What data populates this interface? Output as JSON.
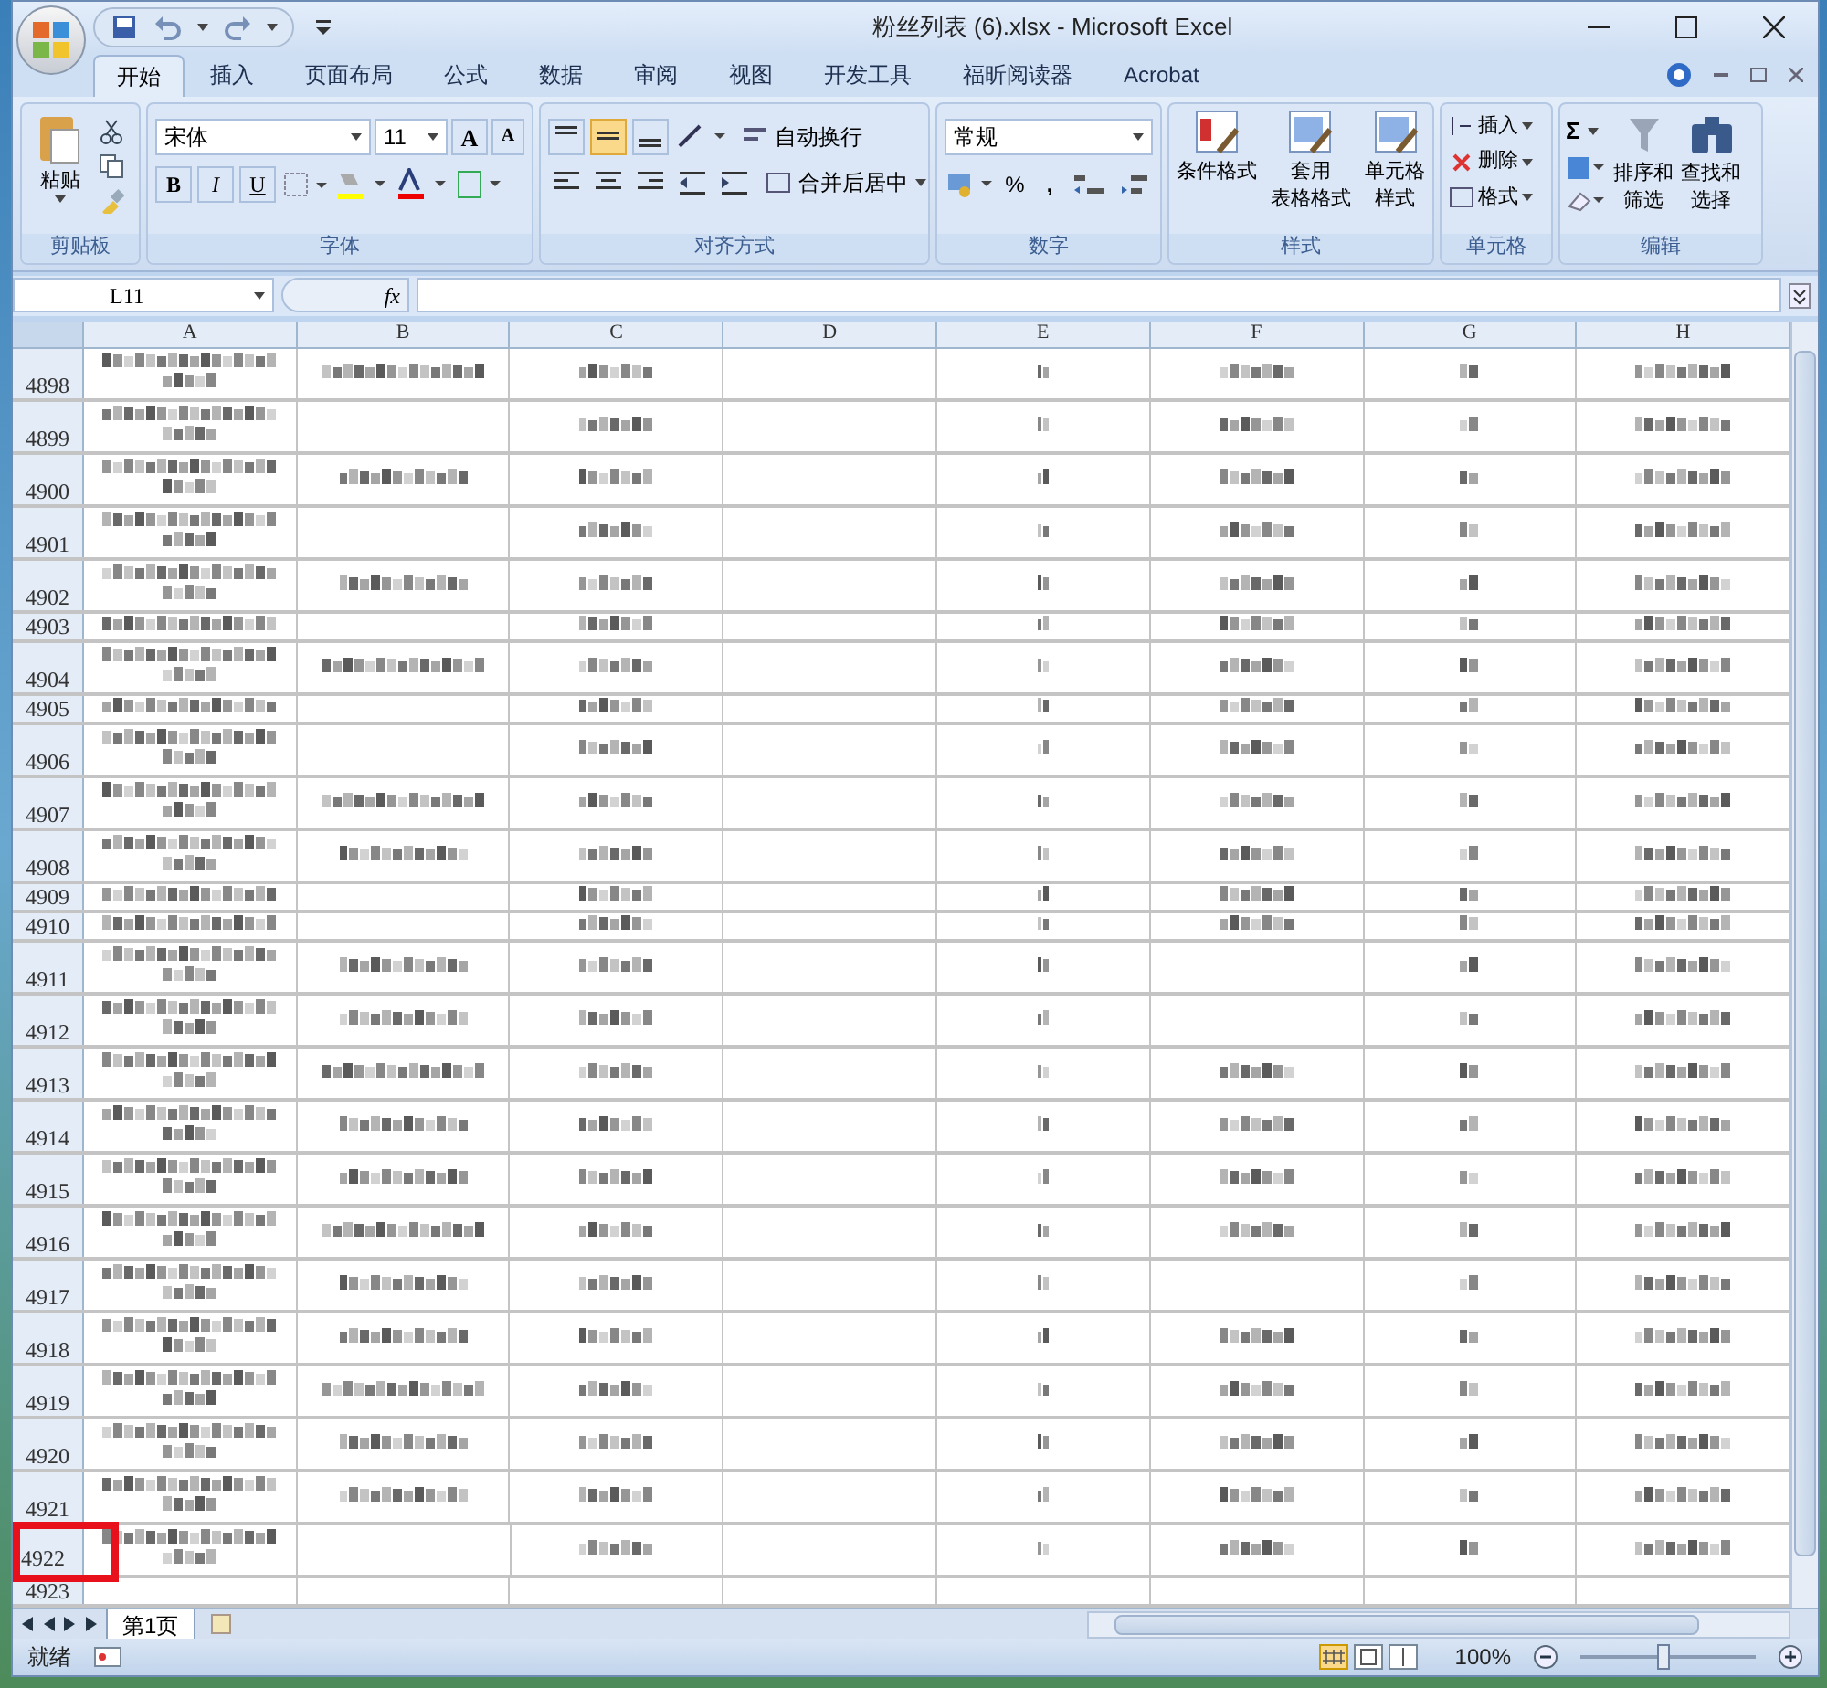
{
  "window": {
    "title": "粉丝列表 (6).xlsx - Microsoft Excel"
  },
  "tabs": [
    {
      "label": "开始",
      "selected": true
    },
    {
      "label": "插入",
      "selected": false
    },
    {
      "label": "页面布局",
      "selected": false
    },
    {
      "label": "公式",
      "selected": false
    },
    {
      "label": "数据",
      "selected": false
    },
    {
      "label": "审阅",
      "selected": false
    },
    {
      "label": "视图",
      "selected": false
    },
    {
      "label": "开发工具",
      "selected": false
    },
    {
      "label": "福昕阅读器",
      "selected": false
    },
    {
      "label": "Acrobat",
      "selected": false
    }
  ],
  "ribbon": {
    "clipboard": {
      "label": "剪贴板",
      "paste": "粘贴"
    },
    "font": {
      "label": "字体",
      "name": "宋体",
      "size": "11",
      "grow": "A",
      "shrink": "A",
      "bold": "B",
      "italic": "I",
      "underline": "U"
    },
    "alignment": {
      "label": "对齐方式",
      "vertical": [
        {
          "selected": false
        },
        {
          "selected": true
        },
        {
          "selected": false
        }
      ],
      "wrap": "自动换行",
      "merge": "合并后居中"
    },
    "number": {
      "label": "数字",
      "format": "常规",
      "percent": "%",
      "comma": ","
    },
    "styles": {
      "label": "样式",
      "buttons": [
        {
          "lines": [
            "条件格式"
          ]
        },
        {
          "lines": [
            "套用",
            "表格格式"
          ]
        },
        {
          "lines": [
            "单元格",
            "样式"
          ]
        }
      ]
    },
    "cells": {
      "label": "单元格",
      "buttons": [
        {
          "kind": "insert",
          "label": "插入"
        },
        {
          "kind": "delete",
          "label": "删除"
        },
        {
          "kind": "format",
          "label": "格式"
        }
      ]
    },
    "editing": {
      "label": "编辑",
      "sum": "Σ",
      "buttons": [
        {
          "kind": "sort",
          "lines": [
            "排序和",
            "筛选"
          ]
        },
        {
          "kind": "find",
          "lines": [
            "查找和",
            "选择"
          ]
        }
      ]
    }
  },
  "formula_bar": {
    "name_box": "L11",
    "function_label": "fx"
  },
  "columns": [
    "A",
    "B",
    "C",
    "D",
    "E",
    "F",
    "G",
    "H"
  ],
  "rows": [
    {
      "number": "4898",
      "tall": true,
      "highlighted": false,
      "filled": [
        true,
        true,
        true,
        false,
        true,
        true,
        true,
        true
      ]
    },
    {
      "number": "4899",
      "tall": true,
      "highlighted": false,
      "filled": [
        true,
        false,
        true,
        false,
        true,
        true,
        true,
        true
      ]
    },
    {
      "number": "4900",
      "tall": true,
      "highlighted": false,
      "filled": [
        true,
        true,
        true,
        false,
        true,
        true,
        true,
        true
      ]
    },
    {
      "number": "4901",
      "tall": true,
      "highlighted": false,
      "filled": [
        true,
        false,
        true,
        false,
        true,
        true,
        true,
        true
      ]
    },
    {
      "number": "4902",
      "tall": true,
      "highlighted": false,
      "filled": [
        true,
        true,
        true,
        false,
        true,
        true,
        true,
        true
      ]
    },
    {
      "number": "4903",
      "tall": false,
      "highlighted": false,
      "filled": [
        true,
        false,
        true,
        false,
        true,
        true,
        true,
        true
      ]
    },
    {
      "number": "4904",
      "tall": true,
      "highlighted": false,
      "filled": [
        true,
        true,
        true,
        false,
        true,
        true,
        true,
        true
      ]
    },
    {
      "number": "4905",
      "tall": false,
      "highlighted": false,
      "filled": [
        true,
        false,
        true,
        false,
        true,
        true,
        true,
        true
      ]
    },
    {
      "number": "4906",
      "tall": true,
      "highlighted": false,
      "filled": [
        true,
        false,
        true,
        false,
        true,
        true,
        true,
        true
      ]
    },
    {
      "number": "4907",
      "tall": true,
      "highlighted": false,
      "filled": [
        true,
        true,
        true,
        false,
        true,
        true,
        true,
        true
      ]
    },
    {
      "number": "4908",
      "tall": true,
      "highlighted": false,
      "filled": [
        true,
        true,
        true,
        false,
        true,
        true,
        true,
        true
      ]
    },
    {
      "number": "4909",
      "tall": false,
      "highlighted": false,
      "filled": [
        true,
        false,
        true,
        false,
        true,
        true,
        true,
        true
      ]
    },
    {
      "number": "4910",
      "tall": false,
      "highlighted": false,
      "filled": [
        true,
        false,
        true,
        false,
        true,
        true,
        true,
        true
      ]
    },
    {
      "number": "4911",
      "tall": true,
      "highlighted": false,
      "filled": [
        true,
        true,
        true,
        false,
        true,
        false,
        true,
        true
      ]
    },
    {
      "number": "4912",
      "tall": true,
      "highlighted": false,
      "filled": [
        true,
        true,
        true,
        false,
        true,
        false,
        true,
        true
      ]
    },
    {
      "number": "4913",
      "tall": true,
      "highlighted": false,
      "filled": [
        true,
        true,
        true,
        false,
        true,
        true,
        true,
        true
      ]
    },
    {
      "number": "4914",
      "tall": true,
      "highlighted": false,
      "filled": [
        true,
        true,
        true,
        false,
        true,
        true,
        true,
        true
      ]
    },
    {
      "number": "4915",
      "tall": true,
      "highlighted": false,
      "filled": [
        true,
        true,
        true,
        false,
        true,
        true,
        true,
        true
      ]
    },
    {
      "number": "4916",
      "tall": true,
      "highlighted": false,
      "filled": [
        true,
        true,
        true,
        false,
        true,
        true,
        true,
        true
      ]
    },
    {
      "number": "4917",
      "tall": true,
      "highlighted": false,
      "filled": [
        true,
        true,
        true,
        false,
        true,
        false,
        true,
        true
      ]
    },
    {
      "number": "4918",
      "tall": true,
      "highlighted": false,
      "filled": [
        true,
        true,
        true,
        false,
        true,
        true,
        true,
        true
      ]
    },
    {
      "number": "4919",
      "tall": true,
      "highlighted": false,
      "filled": [
        true,
        true,
        true,
        false,
        true,
        true,
        true,
        true
      ]
    },
    {
      "number": "4920",
      "tall": true,
      "highlighted": false,
      "filled": [
        true,
        true,
        true,
        false,
        true,
        true,
        true,
        true
      ]
    },
    {
      "number": "4921",
      "tall": true,
      "highlighted": false,
      "filled": [
        true,
        true,
        true,
        false,
        true,
        true,
        true,
        true
      ]
    },
    {
      "number": "4922",
      "tall": true,
      "highlighted": true,
      "filled": [
        true,
        false,
        true,
        false,
        true,
        true,
        true,
        true
      ]
    },
    {
      "number": "4923",
      "tall": false,
      "highlighted": false,
      "filled": [
        false,
        false,
        false,
        false,
        false,
        false,
        false,
        false
      ]
    }
  ],
  "sheet_tabs": [
    {
      "label": "第1页",
      "selected": true
    }
  ],
  "status_bar": {
    "status": "就绪",
    "zoom": "100%",
    "zoom_slider": {
      "level": 0.47
    }
  }
}
